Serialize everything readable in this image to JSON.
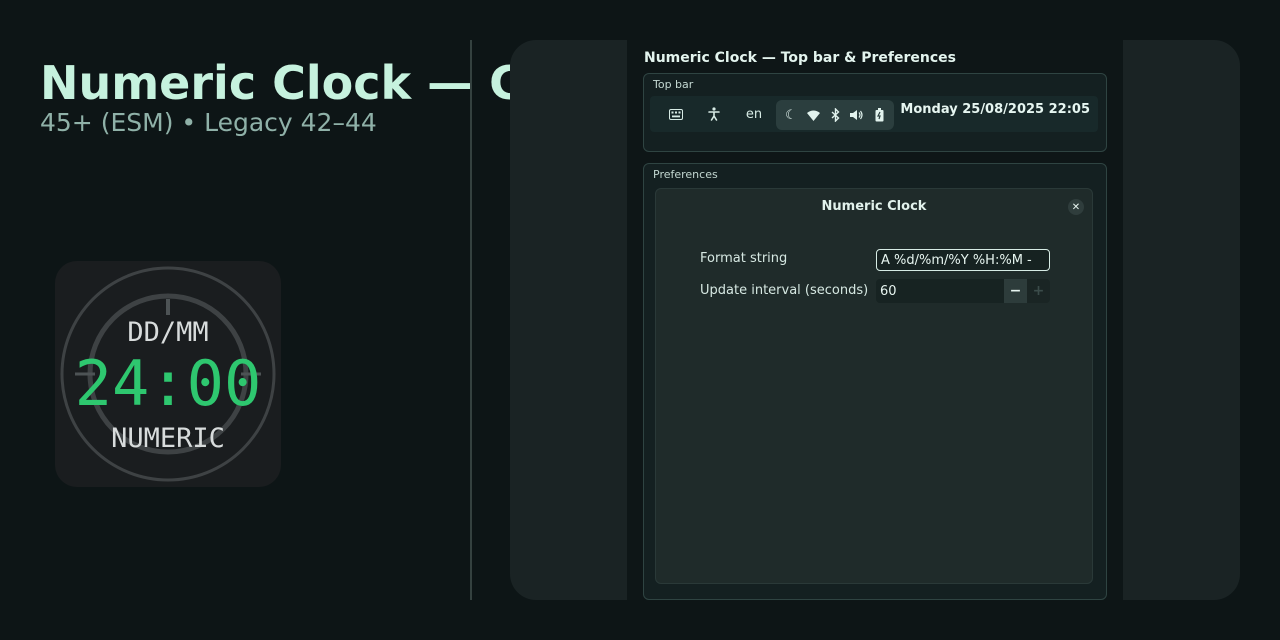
{
  "header": {
    "title": "Numeric Clock — GNOME Shell Extension",
    "subtitle": "45+ (ESM)  •  Legacy 42–44"
  },
  "logo": {
    "top_text": "DD/MM",
    "time_text": "24:00",
    "bottom_text": "NUMERIC",
    "accent": "#2ec76f"
  },
  "panel": {
    "title": "Numeric Clock — Top bar & Preferences",
    "topbar_section": {
      "label": "Top bar",
      "keyboard_icon": "keyboard-icon",
      "accessibility_icon": "accessibility-icon",
      "language": "en",
      "status_icons": [
        "moon-icon",
        "wifi-icon",
        "bluetooth-icon",
        "volume-icon",
        "battery-icon"
      ],
      "clock": "Monday 25/08/2025 22:05"
    },
    "preferences_section": {
      "label": "Preferences",
      "dialog": {
        "title": "Numeric Clock",
        "close_symbol": "✕",
        "format": {
          "label": "Format string",
          "value": "A %d/%m/%Y %H:%M -"
        },
        "interval": {
          "label": "Update interval (seconds)",
          "value": "60",
          "minus": "−",
          "plus": "+"
        }
      }
    }
  },
  "colors": {
    "background": "#0d1516",
    "title": "#c6f2de",
    "accent": "#2ec76f"
  }
}
